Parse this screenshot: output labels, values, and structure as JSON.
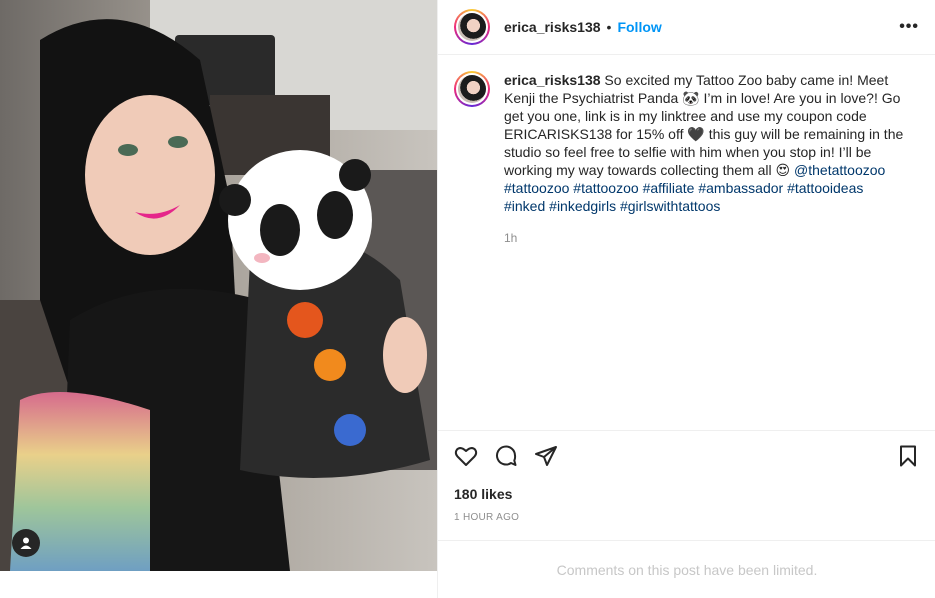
{
  "post": {
    "username": "erica_risks138",
    "separator": "•",
    "follow_label": "Follow",
    "more_label": "•••"
  },
  "caption": {
    "username": "erica_risks138",
    "text_1": " So excited my Tattoo Zoo baby came in! Meet Kenji the Psychiatrist Panda 🐼 I’m in love! Are you in love?! Go get you one, link is in my linktree and use my coupon code ERICARISKS138 for 15% off ",
    "heart": "🖤",
    "text_2": " this guy will be remaining in the studio so feel free to selfie with him when you stop in! I’ll be working my way towards collecting them all ",
    "emoji": "😍",
    "mention": "@thetattoozoo",
    "hashtags": [
      "#tattoozoo",
      "#tattoozoo",
      "#affiliate",
      "#ambassador",
      "#tattooideas",
      "#inked",
      "#inkedgirls",
      "#girlswithtattoos"
    ],
    "age": "1h"
  },
  "stats": {
    "likes": "180 likes",
    "posted": "1 HOUR AGO"
  },
  "footer": {
    "comments_limited": "Comments on this post have been limited."
  },
  "icons": {
    "like": "heart-icon",
    "comment": "comment-icon",
    "share": "share-icon",
    "save": "bookmark-icon",
    "tag": "user-tag-icon"
  },
  "colors": {
    "link_blue": "#0095f6",
    "hashtag": "#00376b",
    "muted": "#8e8e8e"
  }
}
